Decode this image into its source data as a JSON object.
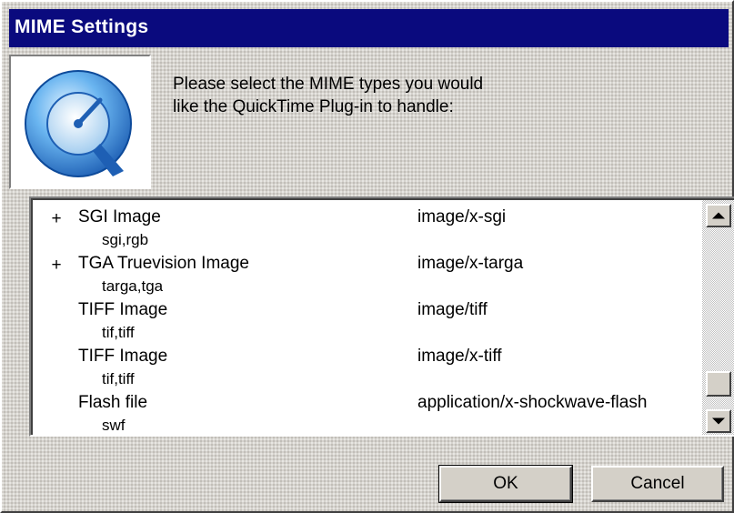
{
  "window": {
    "title": "MIME Settings"
  },
  "prompt": "Please select the MIME types you would like the QuickTime Plug-in to handle:",
  "logo_icon": "quicktime-q-logo",
  "mime_list": [
    {
      "marker": "+",
      "name": "SGI Image",
      "extensions": "sgi,rgb",
      "mime": "image/x-sgi"
    },
    {
      "marker": "+",
      "name": "TGA Truevision Image",
      "extensions": "targa,tga",
      "mime": "image/x-targa"
    },
    {
      "marker": "",
      "name": "TIFF Image",
      "extensions": "tif,tiff",
      "mime": "image/tiff"
    },
    {
      "marker": "",
      "name": "TIFF Image",
      "extensions": "tif,tiff",
      "mime": "image/x-tiff"
    },
    {
      "marker": "",
      "name": "Flash file",
      "extensions": "swf",
      "mime": "application/x-shockwave-flash"
    }
  ],
  "buttons": {
    "ok": "OK",
    "cancel": "Cancel"
  },
  "colors": {
    "titlebar": "#0a0a7e",
    "face": "#d4d0c8"
  }
}
